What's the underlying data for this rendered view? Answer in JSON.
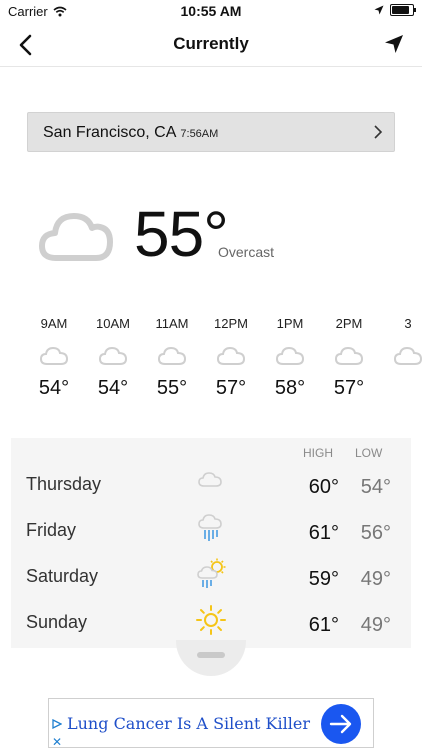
{
  "status_bar": {
    "carrier": "Carrier",
    "time": "10:55 AM"
  },
  "nav": {
    "title": "Currently"
  },
  "location": {
    "name": "San Francisco, CA",
    "time": "7:56AM"
  },
  "current": {
    "temp": "55°",
    "condition": "Overcast",
    "icon": "cloud-icon"
  },
  "hourly": [
    {
      "time": "9AM",
      "temp": "54°",
      "icon": "cloud-icon"
    },
    {
      "time": "10AM",
      "temp": "54°",
      "icon": "cloud-icon"
    },
    {
      "time": "11AM",
      "temp": "55°",
      "icon": "cloud-icon"
    },
    {
      "time": "12PM",
      "temp": "57°",
      "icon": "cloud-icon"
    },
    {
      "time": "1PM",
      "temp": "58°",
      "icon": "cloud-icon"
    },
    {
      "time": "2PM",
      "temp": "57°",
      "icon": "cloud-icon"
    }
  ],
  "daily": {
    "high_label": "HIGH",
    "low_label": "LOW",
    "days": [
      {
        "day": "Thursday",
        "high": "60°",
        "low": "54°",
        "icon": "cloud-icon"
      },
      {
        "day": "Friday",
        "high": "61°",
        "low": "56°",
        "icon": "rain-cloud-icon"
      },
      {
        "day": "Saturday",
        "high": "59°",
        "low": "49°",
        "icon": "sun-rain-icon"
      },
      {
        "day": "Sunday",
        "high": "61°",
        "low": "49°",
        "icon": "sun-icon"
      }
    ]
  },
  "ad": {
    "text": "Lung Cancer Is A Silent Killer",
    "close": "✕",
    "accent": "#1a57f0"
  },
  "colors": {
    "panel_bg": "#f5f5f5",
    "rain": "#6aaee6",
    "sun": "#f5c518"
  }
}
